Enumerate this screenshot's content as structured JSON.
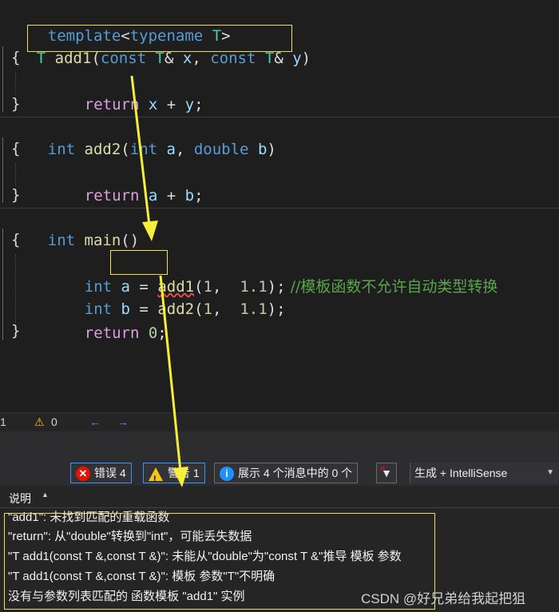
{
  "editor": {
    "lines": {
      "l1": {
        "a": "template",
        "b": "<",
        "c": "typename",
        "d": " T",
        "e": ">"
      },
      "l2": {
        "fold": "T",
        "fn": "add1",
        "p1": "(",
        "k1": "const",
        "t1": " T",
        "a1": "& ",
        "x": "x",
        "cm": ", ",
        "k2": "const",
        "t2": " T",
        "a2": "& ",
        "y": "y",
        "p2": ")"
      },
      "l3": {
        "t": "{"
      },
      "l4": {
        "kw": "return",
        "x": " x",
        "op": " + ",
        "y": "y",
        "sc": ";"
      },
      "l5": {
        "t": "}"
      },
      "l6": {
        "kw": "int",
        "fn": " add2",
        "p1": "(",
        "k1": "int",
        "a": " a",
        "cm": ", ",
        "k2": "double",
        "b": " b",
        "p2": ")"
      },
      "l7": {
        "t": "{"
      },
      "l8": {
        "kw": "return",
        "a": " a",
        "op": " + ",
        "b": "b",
        "sc": ";"
      },
      "l9": {
        "t": "}"
      },
      "l10": {
        "kw": "int",
        "fn": " main",
        "p": "()"
      },
      "l11": {
        "t": "{"
      },
      "l12": {
        "kw": "int",
        "a": " a",
        "eq": " = ",
        "fn": "add1",
        "p1": "(",
        "n1": "1",
        "cm": ", ",
        "n2": " 1.1",
        "p2": ");",
        "comment": " //模板函数不允许自动类型转换"
      },
      "l13": {
        "kw": "int",
        "b": " b",
        "eq": " = ",
        "fn": "add2",
        "p1": "(",
        "n1": "1",
        "cm": ", ",
        "n2": " 1.1",
        "p2": ");"
      },
      "l14": {
        "kw": "return",
        "n": " 0",
        "sc": ";"
      },
      "l15": {
        "t": "}"
      }
    }
  },
  "status": {
    "errors": "1",
    "warnings": "0"
  },
  "toolbar": {
    "errors_label": "错误 4",
    "warnings_label": "警告 1",
    "messages_label": "展示 4 个消息中的 0 个",
    "build_filter": "生成 + IntelliSense"
  },
  "list": {
    "header": "说明",
    "rows": [
      "\"add1\": 未找到匹配的重载函数",
      "\"return\": 从\"double\"转换到\"int\"，可能丢失数据",
      "\"T add1(const T &,const T &)\": 未能从\"double\"为\"const T &\"推导 模板 参数",
      "\"T add1(const T &,const T &)\": 模板 参数\"T\"不明确",
      "没有与参数列表匹配的 函数模板 \"add1\" 实例"
    ]
  },
  "watermark": "CSDN @好兄弟给我起把狙",
  "colors": {
    "annotation_yellow": "#f0e24a",
    "error_red": "#e51400",
    "warning_yellow": "#f5c518",
    "info_blue": "#1e90ff"
  },
  "icons": [
    "error-icon",
    "warning-icon",
    "info-icon",
    "filter-clear-icon",
    "back-arrow-icon",
    "forward-arrow-icon",
    "chevron-down-icon"
  ]
}
